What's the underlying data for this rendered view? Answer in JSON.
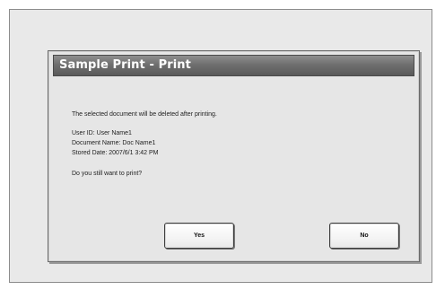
{
  "dialog": {
    "title": "Sample Print - Print",
    "message": "The selected document will be deleted after printing.",
    "details": {
      "user_id": "User ID: User Name1",
      "document_name": "Document Name: Doc Name1",
      "stored_date": "Stored Date: 2007/6/1 3:42 PM"
    },
    "question": "Do you still want to print?",
    "buttons": {
      "yes": "Yes",
      "no": "No"
    }
  }
}
